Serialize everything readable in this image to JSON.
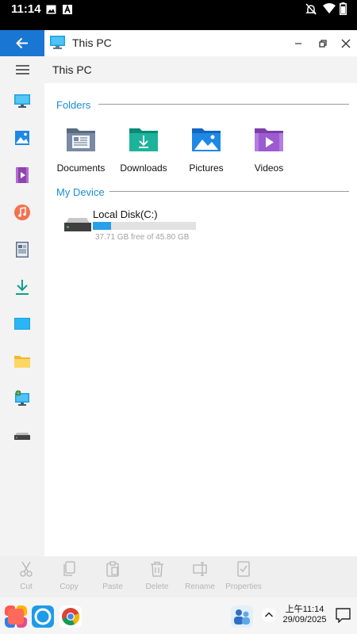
{
  "status_bar": {
    "time": "11:14"
  },
  "window": {
    "title": "This PC",
    "back_icon": "arrow-left-icon",
    "app_icon": "monitor-icon",
    "controls": [
      "minimize-icon",
      "restore-icon",
      "close-icon"
    ]
  },
  "toolbar": {
    "menu_icon": "hamburger-icon",
    "path": "This PC"
  },
  "sidebar": {
    "items": [
      {
        "icon": "monitor-icon",
        "name": "This PC"
      },
      {
        "icon": "pictures-icon",
        "name": "Pictures"
      },
      {
        "icon": "videos-icon",
        "name": "Videos"
      },
      {
        "icon": "music-icon",
        "name": "Music"
      },
      {
        "icon": "documents-icon",
        "name": "Documents"
      },
      {
        "icon": "download-icon",
        "name": "Downloads"
      },
      {
        "icon": "desktop-icon",
        "name": "Desktop"
      },
      {
        "icon": "folder-icon",
        "name": "Folder"
      },
      {
        "icon": "network-icon",
        "name": "Network"
      },
      {
        "icon": "drive-icon",
        "name": "Drive"
      }
    ]
  },
  "sections": {
    "folders_title": "Folders",
    "device_title": "My Device"
  },
  "folders": [
    {
      "label": "Documents",
      "icon": "documents-folder-icon"
    },
    {
      "label": "Downloads",
      "icon": "downloads-folder-icon"
    },
    {
      "label": "Pictures",
      "icon": "pictures-folder-icon"
    },
    {
      "label": "Videos",
      "icon": "videos-folder-icon"
    }
  ],
  "drive": {
    "name": "Local Disk(C:)",
    "free_text": "37.71 GB free of 45.80 GB",
    "used_fraction": 0.177
  },
  "actions": [
    {
      "label": "Cut",
      "icon": "scissors-icon"
    },
    {
      "label": "Copy",
      "icon": "copy-icon"
    },
    {
      "label": "Paste",
      "icon": "paste-icon"
    },
    {
      "label": "Delete",
      "icon": "trash-icon"
    },
    {
      "label": "Rename",
      "icon": "rename-icon"
    },
    {
      "label": "Properties",
      "icon": "properties-icon"
    }
  ],
  "taskbar": {
    "apps": [
      "start-icon",
      "browser-circle-icon",
      "chrome-icon"
    ],
    "people_icon": "people-icon",
    "tray_icon": "chevron-up-icon",
    "clock_time": "上午11:14",
    "clock_date": "29/09/2025",
    "notification_icon": "notification-icon"
  },
  "colors": {
    "accent": "#1976d2",
    "section_title": "#1a8fd6",
    "drive_fill": "#27a0e8"
  }
}
